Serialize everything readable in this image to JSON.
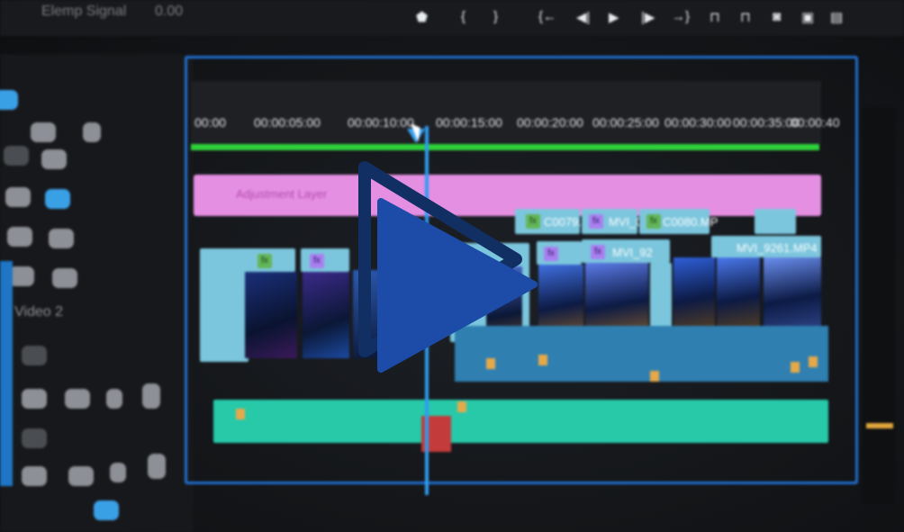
{
  "app": {
    "sequence_name": "Elemp Signal",
    "sequence_extra": "0.00"
  },
  "timeline": {
    "timecodes": [
      "00:00",
      "00:00:05:00",
      "00:00:10:00",
      "00:00:15:00",
      "00:00:20:00",
      "00:00:25:00",
      "00:00:30:00",
      "00:00:35:00",
      "00:00:40"
    ],
    "adjustment_layer_label": "Adjustment Layer",
    "clip_labels": [
      "C0079.",
      "MVI_0",
      "C0080.MP",
      "MVI_92",
      "MVI_9261.MP4"
    ],
    "track_label": "Video 2"
  },
  "overlay": {
    "play_icon": "play-icon",
    "fill_color": "#1c4ba8",
    "outline_color": "#122f63"
  },
  "colors": {
    "adjustment_layer": "#e58fe3",
    "clip_header": "#7cc6dd",
    "audio_track": "#2f7fb0",
    "audio_track_2": "#27c9a9",
    "ruler_bar": "#2fd13b",
    "playhead": "#2f9cf0",
    "frame_border": "#1f6fcf"
  }
}
